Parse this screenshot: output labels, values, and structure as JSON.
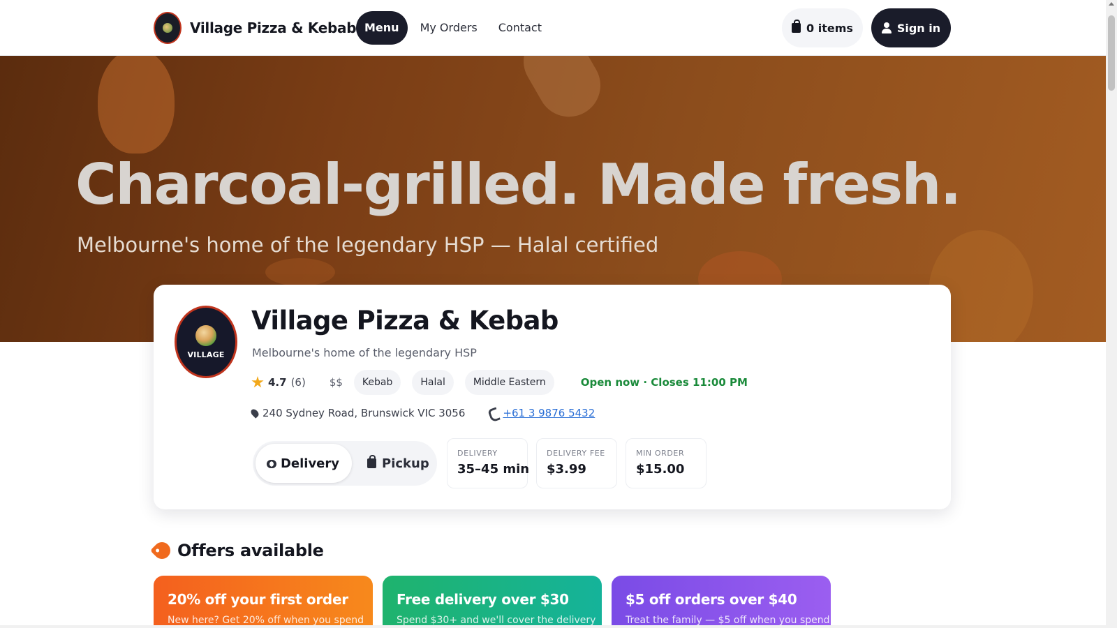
{
  "nav": {
    "brand_name": "Village Pizza & Kebab",
    "links": [
      {
        "label": "Menu",
        "active": true
      },
      {
        "label": "My Orders",
        "active": false
      },
      {
        "label": "Contact",
        "active": false
      }
    ],
    "cart_label": "0 items",
    "signin_label": "Sign in"
  },
  "hero": {
    "title": "Charcoal-grilled. Made fresh.",
    "subtitle": "Melbourne's home of the legendary HSP — Halal certified"
  },
  "restaurant": {
    "logo_text": "VILLAGE",
    "name": "Village Pizza & Kebab",
    "tagline": "Melbourne's home of the legendary HSP",
    "rating": "4.7",
    "rating_count": "(6)",
    "price_level": "$$",
    "tags": [
      "Kebab",
      "Halal",
      "Middle Eastern"
    ],
    "open_status": "Open now · Closes 11:00 PM",
    "address": "240 Sydney Road, Brunswick VIC 3056",
    "phone": "+61 3 9876 5432"
  },
  "order_mode": {
    "delivery_label": "Delivery",
    "pickup_label": "Pickup",
    "selected": "Delivery"
  },
  "stats": [
    {
      "label": "DELIVERY",
      "value": "35–45 min"
    },
    {
      "label": "DELIVERY FEE",
      "value": "$3.99"
    },
    {
      "label": "MIN ORDER",
      "value": "$15.00"
    }
  ],
  "offers": {
    "heading": "Offers available",
    "items": [
      {
        "title": "20% off your first order",
        "description": "New here? Get 20% off when you spend"
      },
      {
        "title": "Free delivery over $30",
        "description": "Spend $30+ and we'll cover the delivery"
      },
      {
        "title": "$5 off orders over $40",
        "description": "Treat the family — $5 off when you spend"
      }
    ]
  },
  "colors": {
    "primary_dark": "#1a1c2a",
    "open_green": "#1a8a3a",
    "link_blue": "#2b6fd6",
    "offer_orange": "#f4601e",
    "offer_green": "#1fb36d",
    "offer_purple": "#7a4be6",
    "star_yellow": "#f2a81a"
  },
  "icons": [
    "bag-icon",
    "user-icon",
    "star-icon",
    "pin-icon",
    "phone-icon",
    "bike-icon",
    "tag-icon"
  ]
}
